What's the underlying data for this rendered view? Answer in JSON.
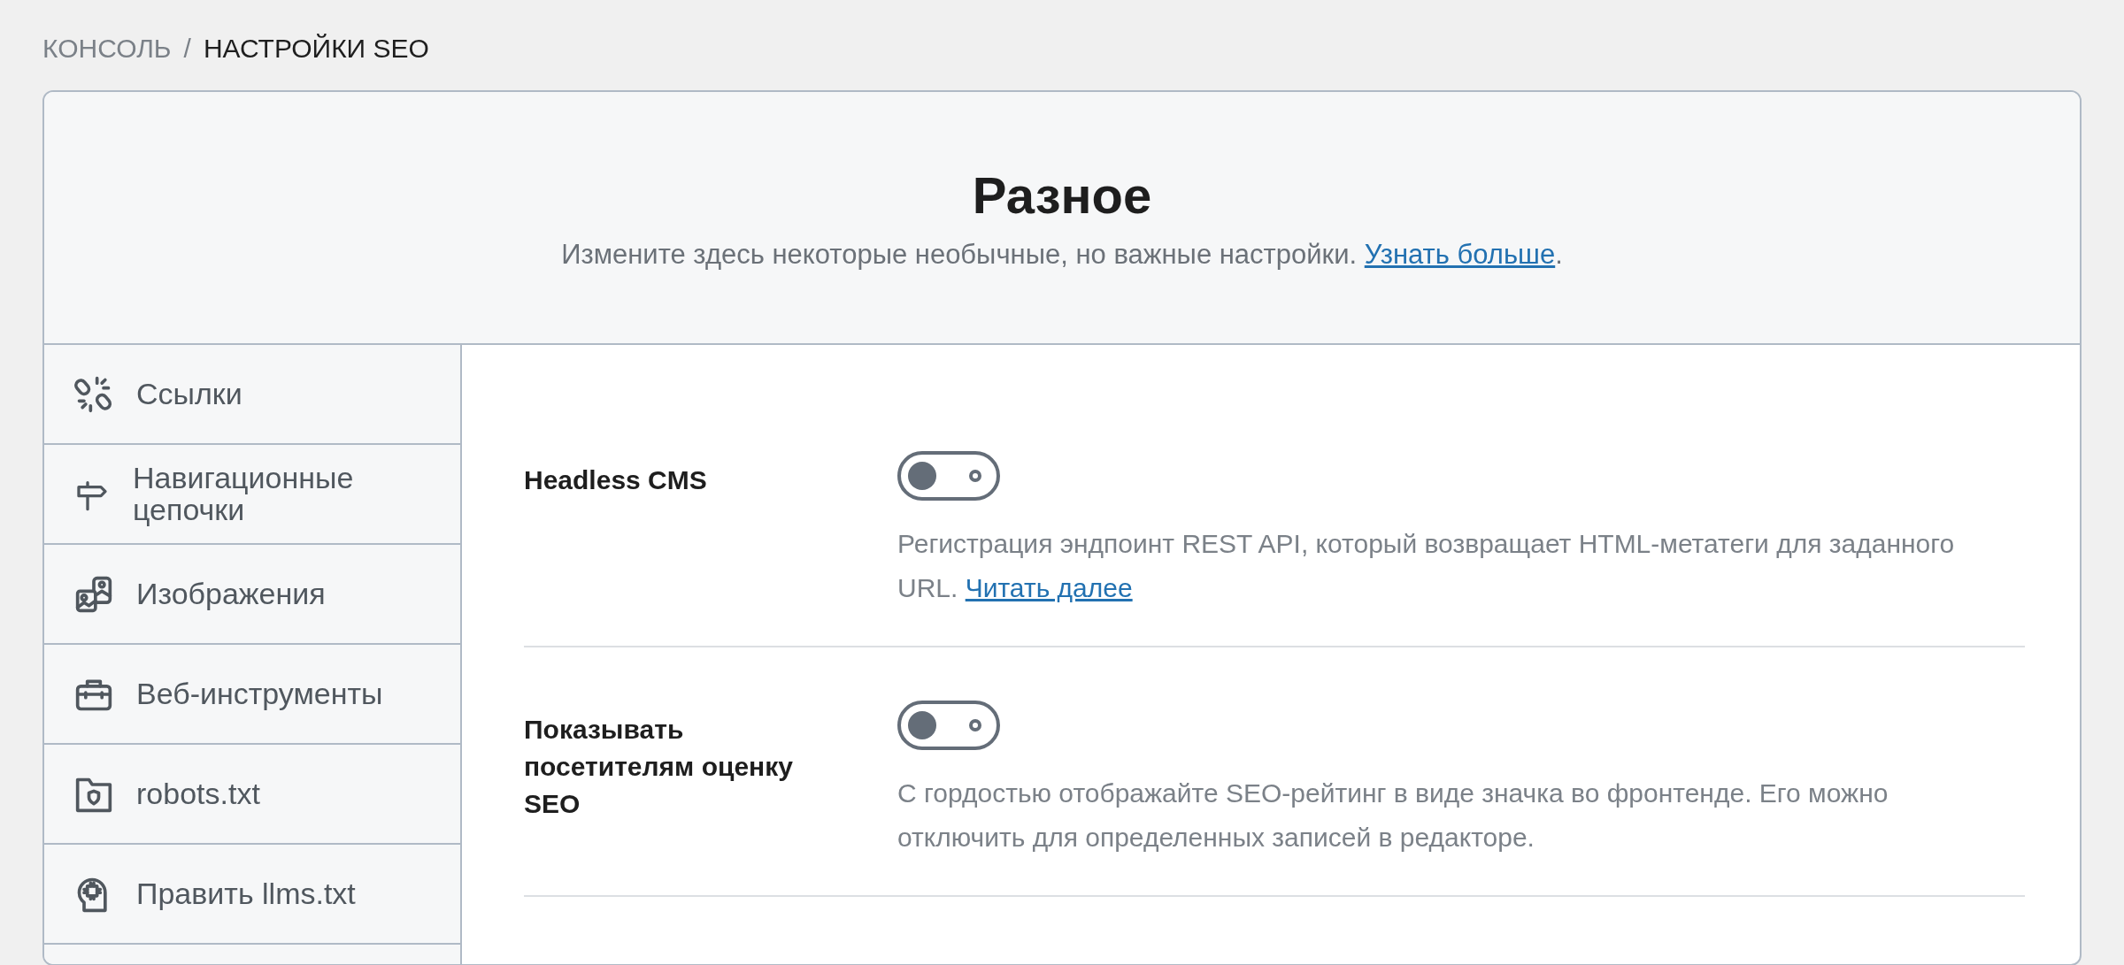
{
  "breadcrumb": {
    "parent": "КОНСОЛЬ",
    "separator": "/",
    "current": "НАСТРОЙКИ SEO"
  },
  "header": {
    "title": "Разное",
    "subtitle": "Измените здесь некоторые необычные, но важные настройки.",
    "link": "Узнать больше",
    "suffix": "."
  },
  "sidebar": {
    "items": [
      {
        "label": "Ссылки"
      },
      {
        "label": "Навигационные цепочки"
      },
      {
        "label": "Изображения"
      },
      {
        "label": "Веб-инструменты"
      },
      {
        "label": "robots.txt"
      },
      {
        "label": "Править llms.txt"
      }
    ]
  },
  "settings": [
    {
      "label": "Headless CMS",
      "on": false,
      "description": "Регистрация эндпоинт REST API, который возвращает HTML-метатеги для заданного URL.",
      "link": "Читать далее"
    },
    {
      "label": "Показывать посетителям оценку SEO",
      "on": false,
      "description": "С гордостью отображайте SEO-рейтинг в виде значка во фронтенде. Его можно отключить для определенных записей в редакторе."
    }
  ]
}
